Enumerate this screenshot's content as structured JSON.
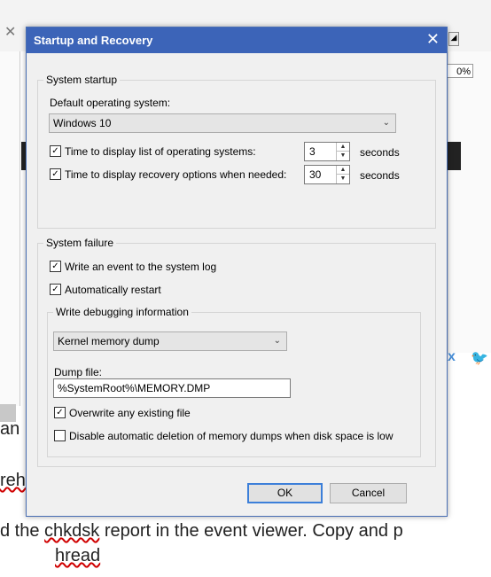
{
  "background": {
    "zoom_fragment": "0%",
    "line1": "an",
    "line2": "reh",
    "line3_prefix": "d the ",
    "line3_misspelled": "chkdsk",
    "line3_suffix": " report in the event viewer. Copy and p",
    "line4_prefix": "",
    "line4_misspelled": "hread"
  },
  "dialog": {
    "title": "Startup and Recovery",
    "system_startup": {
      "legend": "System startup",
      "default_os_label": "Default operating system:",
      "default_os_value": "Windows 10",
      "display_list": {
        "label": "Time to display list of operating systems:",
        "checked": true,
        "value": "3",
        "unit": "seconds"
      },
      "display_recovery": {
        "label": "Time to display recovery options when needed:",
        "checked": true,
        "value": "30",
        "unit": "seconds"
      }
    },
    "system_failure": {
      "legend": "System failure",
      "write_event": {
        "label": "Write an event to the system log",
        "checked": true
      },
      "auto_restart": {
        "label": "Automatically restart",
        "checked": true
      },
      "debug": {
        "legend": "Write debugging information",
        "dump_type": "Kernel memory dump",
        "dump_file_label": "Dump file:",
        "dump_file_value": "%SystemRoot%\\MEMORY.DMP",
        "overwrite": {
          "label": "Overwrite any existing file",
          "checked": true
        },
        "disable_auto_delete": {
          "label": "Disable automatic deletion of memory dumps when disk space is low",
          "checked": false
        }
      }
    },
    "ok_label": "OK",
    "cancel_label": "Cancel"
  },
  "icons": {
    "close": "close-icon",
    "check": "checkmark-icon",
    "chevron": "chevron-down-icon"
  },
  "colors": {
    "titlebar": "#3c64b8",
    "dialog_bg": "#f0f0f0",
    "default_button_border": "#3c7fd9"
  }
}
